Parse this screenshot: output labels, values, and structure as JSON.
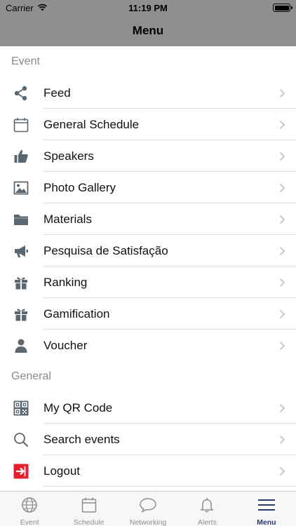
{
  "status_bar": {
    "carrier": "Carrier",
    "time": "11:19 PM"
  },
  "nav": {
    "title": "Menu"
  },
  "sections": [
    {
      "header": "Event",
      "items": [
        {
          "label": "Feed",
          "icon": "share-icon"
        },
        {
          "label": "General Schedule",
          "icon": "calendar-icon"
        },
        {
          "label": "Speakers",
          "icon": "thumbs-up-icon"
        },
        {
          "label": "Photo Gallery",
          "icon": "image-icon"
        },
        {
          "label": "Materials",
          "icon": "folder-icon"
        },
        {
          "label": "Pesquisa de Satisfação",
          "icon": "megaphone-icon"
        },
        {
          "label": "Ranking",
          "icon": "gift-icon"
        },
        {
          "label": "Gamification",
          "icon": "gift-icon"
        },
        {
          "label": "Voucher",
          "icon": "person-icon"
        }
      ]
    },
    {
      "header": "General",
      "items": [
        {
          "label": "My QR Code",
          "icon": "qr-code-icon"
        },
        {
          "label": "Search events",
          "icon": "search-icon"
        },
        {
          "label": "Logout",
          "icon": "logout-icon"
        }
      ]
    }
  ],
  "tab_bar": {
    "tabs": [
      {
        "label": "Event",
        "icon": "globe-icon"
      },
      {
        "label": "Schedule",
        "icon": "calendar-icon"
      },
      {
        "label": "Networking",
        "icon": "chat-bubble-icon"
      },
      {
        "label": "Alerts",
        "icon": "bell-icon"
      },
      {
        "label": "Menu",
        "icon": "hamburger-menu-icon"
      }
    ],
    "active": "Menu"
  },
  "colors": {
    "header_bg": "#8f8f8f",
    "icon_gray": "#5b6770",
    "logout_red": "#e5202e",
    "active_tab": "#2b3b6f"
  }
}
